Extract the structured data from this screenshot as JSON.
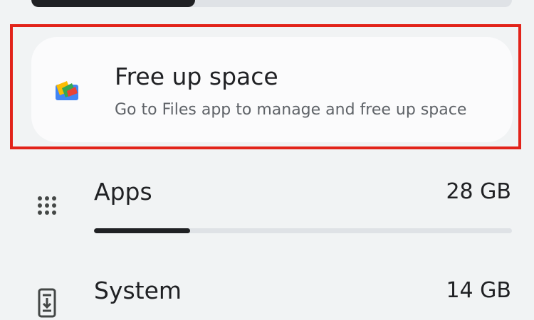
{
  "top_storage_bar": {
    "fill_fraction": 0.34
  },
  "free_up_space": {
    "title": "Free up space",
    "subtitle": "Go to Files app to manage and free up space",
    "icon": "files-app-icon"
  },
  "storage_rows": [
    {
      "label": "Apps",
      "value": "28 GB",
      "icon": "apps-grid-icon",
      "usage_fraction": 0.23
    },
    {
      "label": "System",
      "value": "14 GB",
      "icon": "system-update-icon"
    }
  ],
  "colors": {
    "background": "#f1f3f4",
    "card": "#fbfbfc",
    "highlight": "#e2231a",
    "bar_track": "#dfe2e6",
    "bar_fill": "#202124",
    "files_blue": "#4285f4",
    "files_yellow": "#fbbc04",
    "files_green": "#34a853",
    "files_red": "#ea4335"
  }
}
